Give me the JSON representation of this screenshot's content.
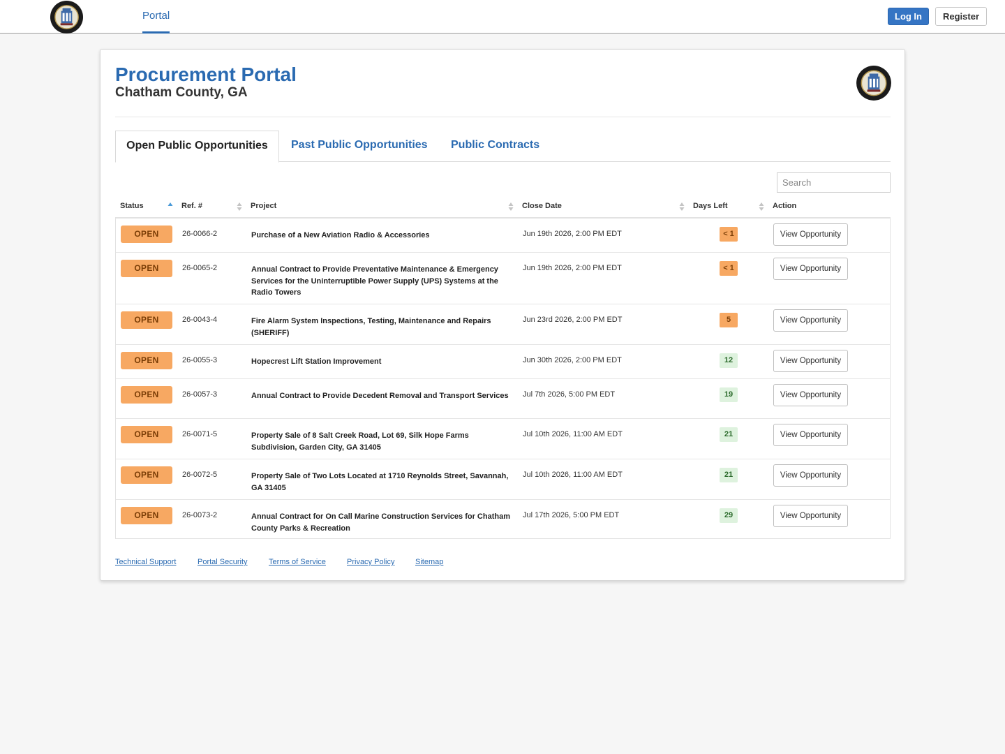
{
  "nav": {
    "portal_label": "Portal",
    "login_label": "Log In",
    "register_label": "Register"
  },
  "header": {
    "title": "Procurement Portal",
    "subtitle": "Chatham County, GA"
  },
  "tabs": [
    {
      "label": "Open Public Opportunities",
      "active": true
    },
    {
      "label": "Past Public Opportunities",
      "active": false
    },
    {
      "label": "Public Contracts",
      "active": false
    }
  ],
  "search": {
    "placeholder": "Search"
  },
  "table": {
    "columns": [
      "Status",
      "Ref. #",
      "Project",
      "Close Date",
      "Days Left",
      "Action"
    ],
    "rows": [
      {
        "status": "OPEN",
        "ref": "26-0066-2",
        "project": "Purchase of a New Aviation Radio & Accessories",
        "close_date": "Jun 19th 2026, 2:00 PM EDT",
        "days_left": "< 1",
        "days_color": "orange",
        "action": "View Opportunity"
      },
      {
        "status": "OPEN",
        "ref": "26-0065-2",
        "project": "Annual Contract to Provide Preventative Maintenance & Emergency Services for the Uninterruptible Power Supply (UPS) Systems at the Radio Towers",
        "close_date": "Jun 19th 2026, 2:00 PM EDT",
        "days_left": "< 1",
        "days_color": "orange",
        "action": "View Opportunity"
      },
      {
        "status": "OPEN",
        "ref": "26-0043-4",
        "project": "Fire Alarm System Inspections, Testing, Maintenance and Repairs (SHERIFF)",
        "close_date": "Jun 23rd 2026, 2:00 PM EDT",
        "days_left": "5",
        "days_color": "orange",
        "action": "View Opportunity"
      },
      {
        "status": "OPEN",
        "ref": "26-0055-3",
        "project": "Hopecrest Lift Station Improvement",
        "close_date": "Jun 30th 2026, 2:00 PM EDT",
        "days_left": "12",
        "days_color": "green",
        "action": "View Opportunity"
      },
      {
        "status": "OPEN",
        "ref": "26-0057-3",
        "project": "Annual Contract to Provide Decedent Removal and Transport Services",
        "close_date": "Jul 7th 2026, 5:00 PM EDT",
        "days_left": "19",
        "days_color": "green",
        "action": "View Opportunity"
      },
      {
        "status": "OPEN",
        "ref": "26-0071-5",
        "project": "Property Sale of 8 Salt Creek Road, Lot 69, Silk Hope Farms Subdivision, Garden City, GA 31405",
        "close_date": "Jul 10th 2026, 11:00 AM EDT",
        "days_left": "21",
        "days_color": "green",
        "action": "View Opportunity"
      },
      {
        "status": "OPEN",
        "ref": "26-0072-5",
        "project": "Property Sale of Two Lots Located at 1710 Reynolds Street, Savannah, GA 31405",
        "close_date": "Jul 10th 2026, 11:00 AM EDT",
        "days_left": "21",
        "days_color": "green",
        "action": "View Opportunity"
      },
      {
        "status": "OPEN",
        "ref": "26-0073-2",
        "project": "Annual Contract for On Call Marine Construction Services for Chatham County Parks & Recreation",
        "close_date": "Jul 17th 2026, 5:00 PM EDT",
        "days_left": "29",
        "days_color": "green",
        "action": "View Opportunity"
      }
    ]
  },
  "footer": {
    "links": [
      "Technical Support",
      "Portal Security",
      "Terms of Service",
      "Privacy Policy",
      "Sitemap"
    ]
  },
  "colors": {
    "brand_blue": "#2a6ab1",
    "status_orange": "#f7a862",
    "days_green_bg": "#def2de"
  },
  "icons": {
    "logo": "county-seal-icon",
    "sort": "sort-icon"
  }
}
